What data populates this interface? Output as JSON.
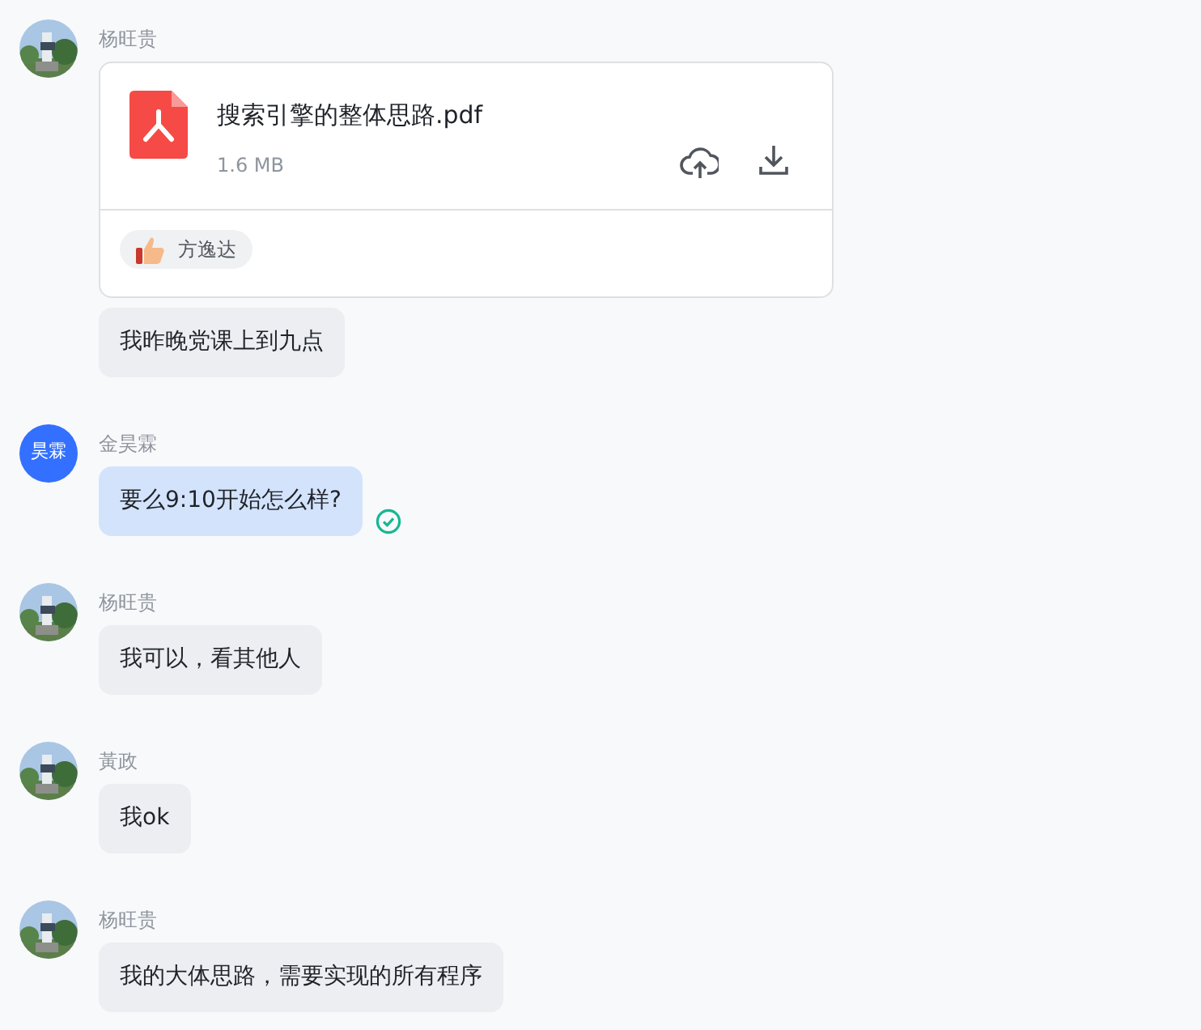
{
  "messages_groups": [
    {
      "sender": "杨旺贵",
      "avatar": {
        "kind": "picture"
      },
      "outgoing": false,
      "messages": [
        {
          "kind": "file",
          "file_name": "搜索引擎的整体思路.pdf",
          "file_size": "1.6 MB",
          "reactions": [
            {
              "user": "方逸达"
            }
          ]
        },
        {
          "kind": "text",
          "text": "我昨晚党课上到九点",
          "read": false
        }
      ]
    },
    {
      "sender": "金昊霖",
      "avatar": {
        "kind": "initials",
        "text": "昊霖"
      },
      "outgoing": true,
      "messages": [
        {
          "kind": "text",
          "text": "要么9:10开始怎么样?",
          "read": true
        }
      ]
    },
    {
      "sender": "杨旺贵",
      "avatar": {
        "kind": "picture"
      },
      "outgoing": false,
      "messages": [
        {
          "kind": "text",
          "text": "我可以，看其他人",
          "read": false
        }
      ]
    },
    {
      "sender": "黃政",
      "avatar": {
        "kind": "picture"
      },
      "outgoing": false,
      "messages": [
        {
          "kind": "text",
          "text": "我ok",
          "read": false
        }
      ]
    },
    {
      "sender": "杨旺贵",
      "avatar": {
        "kind": "picture"
      },
      "outgoing": false,
      "messages": [
        {
          "kind": "text",
          "text": "我的大体思路，需要实现的所有程序",
          "read": false
        }
      ]
    }
  ]
}
